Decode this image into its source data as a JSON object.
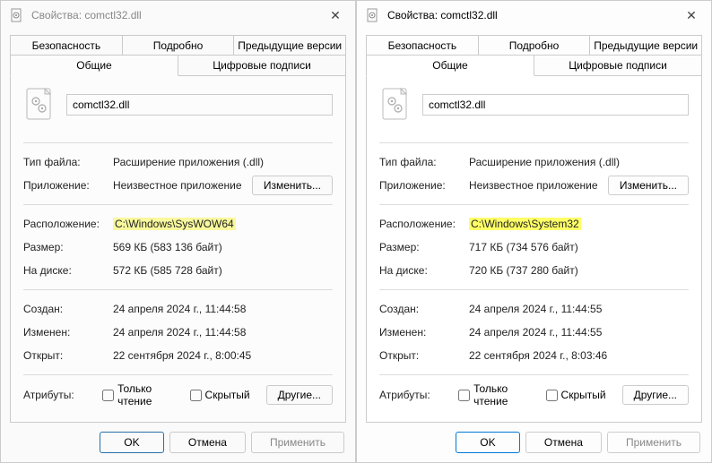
{
  "left": {
    "title": "Свойства: comctl32.dll",
    "tabs": {
      "security": "Безопасность",
      "details": "Подробно",
      "previous": "Предыдущие версии",
      "general": "Общие",
      "signatures": "Цифровые подписи"
    },
    "filename": "comctl32.dll",
    "labels": {
      "filetype": "Тип файла:",
      "app": "Приложение:",
      "location": "Расположение:",
      "size": "Размер:",
      "disksize": "На диске:",
      "created": "Создан:",
      "modified": "Изменен:",
      "accessed": "Открыт:",
      "attributes": "Атрибуты:",
      "readonly": "Только чтение",
      "hidden": "Скрытый"
    },
    "values": {
      "filetype": "Расширение приложения (.dll)",
      "app": "Неизвестное приложение",
      "location": "C:\\Windows\\SysWOW64",
      "size": "569 КБ (583 136 байт)",
      "disksize": "572 КБ (585 728 байт)",
      "created": "24 апреля 2024 г., 11:44:58",
      "modified": "24 апреля 2024 г., 11:44:58",
      "accessed": "22 сентября 2024 г., 8:00:45"
    },
    "buttons": {
      "change": "Изменить...",
      "other": "Другие...",
      "ok": "OK",
      "cancel": "Отмена",
      "apply": "Применить"
    }
  },
  "right": {
    "title": "Свойства: comctl32.dll",
    "tabs": {
      "security": "Безопасность",
      "details": "Подробно",
      "previous": "Предыдущие версии",
      "general": "Общие",
      "signatures": "Цифровые подписи"
    },
    "filename": "comctl32.dll",
    "labels": {
      "filetype": "Тип файла:",
      "app": "Приложение:",
      "location": "Расположение:",
      "size": "Размер:",
      "disksize": "На диске:",
      "created": "Создан:",
      "modified": "Изменен:",
      "accessed": "Открыт:",
      "attributes": "Атрибуты:",
      "readonly": "Только чтение",
      "hidden": "Скрытый"
    },
    "values": {
      "filetype": "Расширение приложения (.dll)",
      "app": "Неизвестное приложение",
      "location": "C:\\Windows\\System32",
      "size": "717 КБ (734 576 байт)",
      "disksize": "720 КБ (737 280 байт)",
      "created": "24 апреля 2024 г., 11:44:55",
      "modified": "24 апреля 2024 г., 11:44:55",
      "accessed": "22 сентября 2024 г., 8:03:46"
    },
    "buttons": {
      "change": "Изменить...",
      "other": "Другие...",
      "ok": "OK",
      "cancel": "Отмена",
      "apply": "Применить"
    }
  }
}
